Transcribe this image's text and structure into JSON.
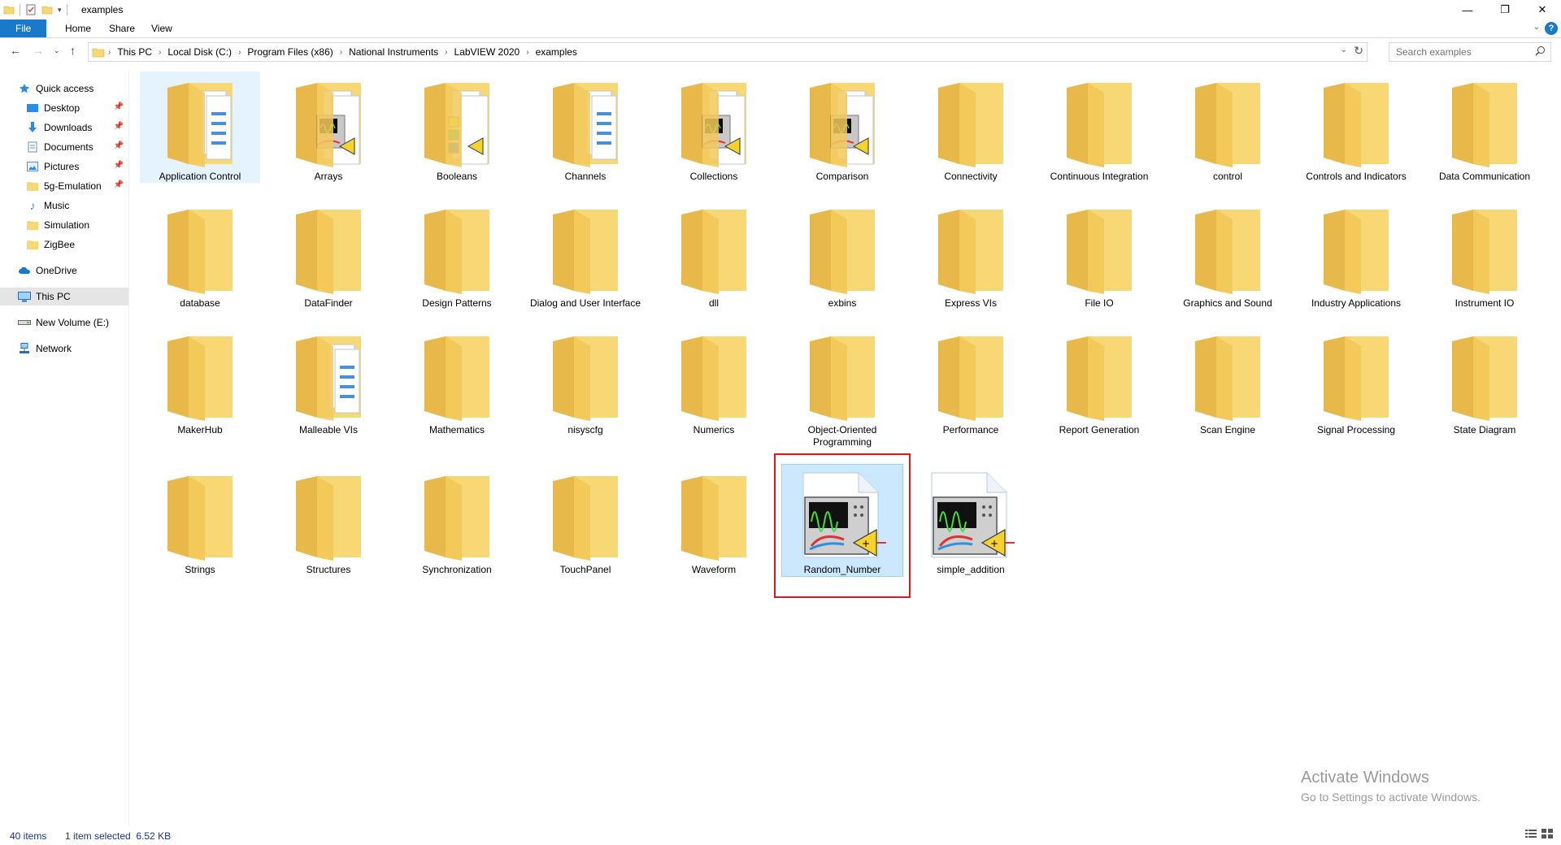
{
  "window": {
    "title": "examples"
  },
  "ribbon": {
    "tabs": [
      "File",
      "Home",
      "Share",
      "View"
    ]
  },
  "address": {
    "crumbs": [
      "This PC",
      "Local Disk (C:)",
      "Program Files (x86)",
      "National Instruments",
      "LabVIEW 2020",
      "examples"
    ]
  },
  "search": {
    "placeholder": "Search examples"
  },
  "nav_pane": {
    "items": [
      {
        "label": "Quick access",
        "icon": "star-icon",
        "pinned": false
      },
      {
        "label": "Desktop",
        "icon": "desktop-icon",
        "pinned": true
      },
      {
        "label": "Downloads",
        "icon": "download-icon",
        "pinned": true
      },
      {
        "label": "Documents",
        "icon": "document-icon",
        "pinned": true
      },
      {
        "label": "Pictures",
        "icon": "picture-icon",
        "pinned": true
      },
      {
        "label": "5g-Emulation",
        "icon": "folder-icon",
        "pinned": true
      },
      {
        "label": "Music",
        "icon": "music-icon",
        "pinned": false
      },
      {
        "label": "Simulation",
        "icon": "folder-icon",
        "pinned": false
      },
      {
        "label": "ZigBee",
        "icon": "folder-icon",
        "pinned": false
      },
      {
        "label": "OneDrive",
        "icon": "cloud-icon",
        "pinned": false
      },
      {
        "label": "This PC",
        "icon": "computer-icon",
        "pinned": false
      },
      {
        "label": "New Volume (E:)",
        "icon": "drive-icon",
        "pinned": false
      },
      {
        "label": "Network",
        "icon": "network-icon",
        "pinned": false
      }
    ]
  },
  "files": [
    {
      "name": "Application Control",
      "kind": "folder-docs"
    },
    {
      "name": "Arrays",
      "kind": "folder-vi"
    },
    {
      "name": "Booleans",
      "kind": "folder-bool"
    },
    {
      "name": "Channels",
      "kind": "folder-docs"
    },
    {
      "name": "Collections",
      "kind": "folder-vi"
    },
    {
      "name": "Comparison",
      "kind": "folder-vi"
    },
    {
      "name": "Connectivity",
      "kind": "folder"
    },
    {
      "name": "Continuous Integration",
      "kind": "folder"
    },
    {
      "name": "control",
      "kind": "folder"
    },
    {
      "name": "Controls and Indicators",
      "kind": "folder"
    },
    {
      "name": "Data Communication",
      "kind": "folder"
    },
    {
      "name": "database",
      "kind": "folder"
    },
    {
      "name": "DataFinder",
      "kind": "folder"
    },
    {
      "name": "Design Patterns",
      "kind": "folder"
    },
    {
      "name": "Dialog and User Interface",
      "kind": "folder"
    },
    {
      "name": "dll",
      "kind": "folder"
    },
    {
      "name": "exbins",
      "kind": "folder"
    },
    {
      "name": "Express VIs",
      "kind": "folder"
    },
    {
      "name": "File IO",
      "kind": "folder"
    },
    {
      "name": "Graphics and Sound",
      "kind": "folder"
    },
    {
      "name": "Industry Applications",
      "kind": "folder"
    },
    {
      "name": "Instrument IO",
      "kind": "folder"
    },
    {
      "name": "MakerHub",
      "kind": "folder"
    },
    {
      "name": "Malleable VIs",
      "kind": "folder-docs"
    },
    {
      "name": "Mathematics",
      "kind": "folder"
    },
    {
      "name": "nisyscfg",
      "kind": "folder"
    },
    {
      "name": "Numerics",
      "kind": "folder"
    },
    {
      "name": "Object-Oriented Programming",
      "kind": "folder"
    },
    {
      "name": "Performance",
      "kind": "folder"
    },
    {
      "name": "Report Generation",
      "kind": "folder"
    },
    {
      "name": "Scan Engine",
      "kind": "folder"
    },
    {
      "name": "Signal Processing",
      "kind": "folder"
    },
    {
      "name": "State Diagram",
      "kind": "folder"
    },
    {
      "name": "Strings",
      "kind": "folder"
    },
    {
      "name": "Structures",
      "kind": "folder"
    },
    {
      "name": "Synchronization",
      "kind": "folder"
    },
    {
      "name": "TouchPanel",
      "kind": "folder"
    },
    {
      "name": "Waveform",
      "kind": "folder"
    },
    {
      "name": "Random_Number",
      "kind": "vi-file"
    },
    {
      "name": "simple_addition",
      "kind": "vi-file"
    }
  ],
  "status": {
    "item_count": "40 items",
    "selection": "1 item selected  6.52 KB"
  },
  "watermark": {
    "line1": "Activate Windows",
    "line2": "Go to Settings to activate Windows."
  },
  "colors": {
    "accent": "#1979ca",
    "selection": "#cce8ff",
    "highlight_box": "#e0161c",
    "folder": "#f8d775"
  }
}
